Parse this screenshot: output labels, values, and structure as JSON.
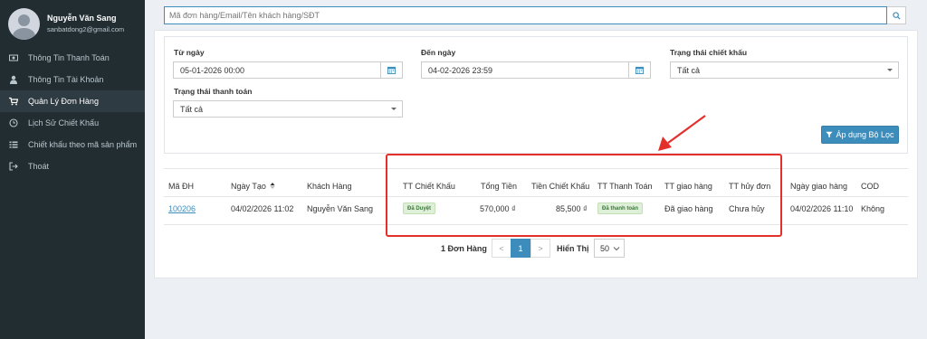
{
  "sidebar": {
    "user_name": "Nguyễn Văn Sang",
    "user_email": "sanbatdong2@gmail.com",
    "items": [
      {
        "label": "Thông Tin Thanh Toán",
        "icon": "money-icon"
      },
      {
        "label": "Thông Tin Tài Khoản",
        "icon": "user-icon"
      },
      {
        "label": "Quản Lý Đơn Hàng",
        "icon": "cart-icon",
        "active": true
      },
      {
        "label": "Lịch Sử Chiết Khấu",
        "icon": "clock-icon"
      },
      {
        "label": "Chiết khấu theo mã sản phẩm",
        "icon": "list-icon"
      },
      {
        "label": "Thoát",
        "icon": "sign-out-icon"
      }
    ]
  },
  "search": {
    "placeholder": "Mã đơn hàng/Email/Tên khách hàng/SĐT"
  },
  "filters": {
    "from_label": "Từ ngày",
    "from_value": "05-01-2026 00:00",
    "to_label": "Đến ngày",
    "to_value": "04-02-2026 23:59",
    "discount_status_label": "Trạng thái chiết khấu",
    "discount_status_value": "Tất cả",
    "payment_status_label": "Trạng thái thanh toán",
    "payment_status_value": "Tất cả",
    "apply_label": "Áp dụng Bộ Lọc"
  },
  "table": {
    "headers": [
      "Mã ĐH",
      "Ngày Tạo",
      "Khách Hàng",
      "TT Chiết Khấu",
      "Tổng Tiền",
      "Tiền Chiết Khấu",
      "TT Thanh Toán",
      "TT giao hàng",
      "TT hủy đơn",
      "Ngày giao hàng",
      "COD"
    ],
    "rows": [
      {
        "order_id": "100206",
        "created": "04/02/2026 11:02",
        "customer": "Nguyễn Văn Sang",
        "discount_status": "Đã Duyệt",
        "total": "570,000 ₫",
        "discount_amount": "85,500 ₫",
        "payment_status": "Đã thanh toán",
        "delivery_status": "Đã giao hàng",
        "cancel_status": "Chưa hủy",
        "delivery_date": "04/02/2026 11:10",
        "cod": "Không"
      }
    ]
  },
  "pagination": {
    "count_label": "1 Đơn Hàng",
    "prev": "<",
    "current": "1",
    "next": ">",
    "show_label": "Hiển Thị",
    "page_size": "50"
  },
  "colors": {
    "sidebar_bg": "#222d32",
    "accent": "#3c8dbc",
    "annotation": "#e4302b",
    "badge_bg": "#dff0d8"
  }
}
